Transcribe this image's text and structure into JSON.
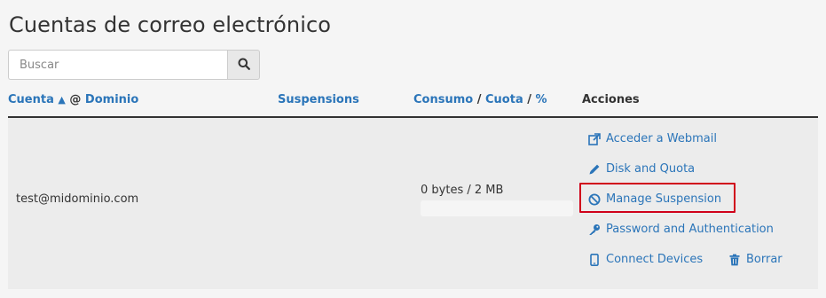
{
  "page": {
    "title": "Cuentas de correo electrónico"
  },
  "search": {
    "placeholder": "Buscar"
  },
  "table": {
    "headers": {
      "cuenta": "Cuenta",
      "sort_arrow": "▲",
      "at": "@",
      "dominio": "Dominio",
      "suspensions": "Suspensions",
      "consumo": "Consumo",
      "slash1": "/",
      "cuota": "Cuota",
      "slash2": "/",
      "percent": "%",
      "acciones": "Acciones"
    },
    "rows": [
      {
        "account": "test@midominio.com",
        "usage": "0 bytes / 2 MB",
        "usage_fraction": 0,
        "actions": {
          "webmail": "Acceder a Webmail",
          "disk": "Disk and Quota",
          "suspension": "Manage Suspension",
          "password": "Password and Authentication",
          "devices": "Connect Devices",
          "delete": "Borrar"
        }
      }
    ]
  },
  "colors": {
    "link": "#2b75b9",
    "highlight": "#d0021b"
  },
  "icons": [
    "search-icon",
    "external-link-icon",
    "pencil-icon",
    "ban-icon",
    "key-icon",
    "mobile-icon",
    "trash-icon"
  ]
}
